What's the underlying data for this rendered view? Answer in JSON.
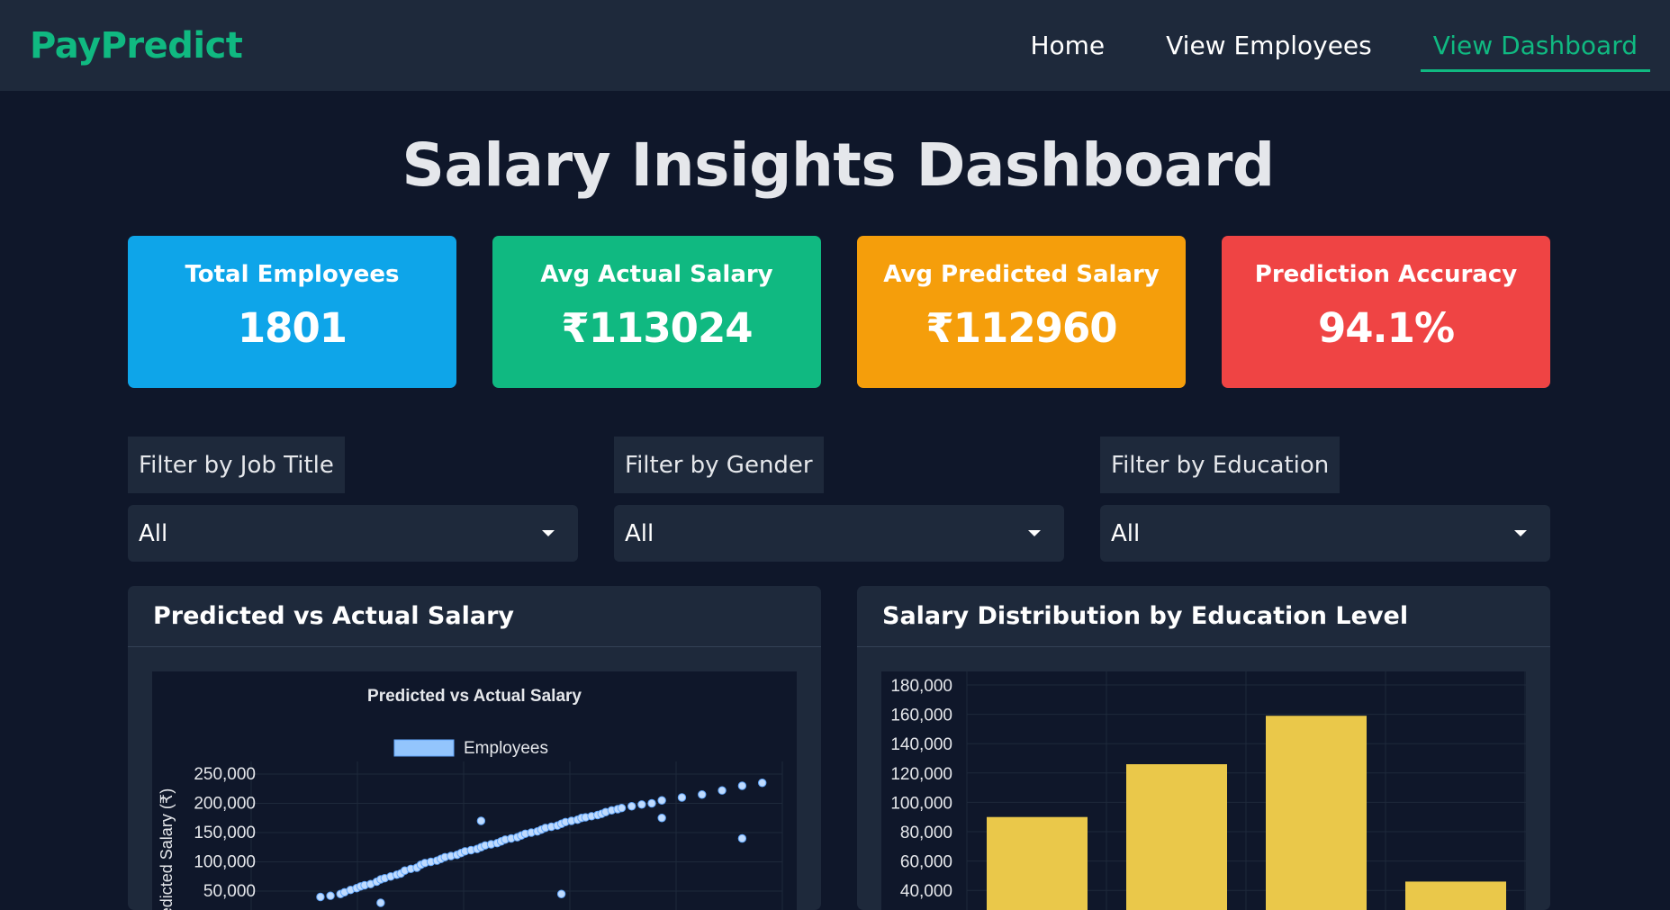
{
  "navbar": {
    "brand": "PayPredict",
    "links": [
      "Home",
      "View Employees",
      "View Dashboard"
    ],
    "active_link": "View Dashboard"
  },
  "page_title": "Salary Insights Dashboard",
  "stats": [
    {
      "label": "Total Employees",
      "value": "1801",
      "color": "#0ea5e9"
    },
    {
      "label": "Avg Actual Salary",
      "value": "₹113024",
      "color": "#10b981"
    },
    {
      "label": "Avg Predicted Salary",
      "value": "₹112960",
      "color": "#f59e0b"
    },
    {
      "label": "Prediction Accuracy",
      "value": "94.1%",
      "color": "#ef4444"
    }
  ],
  "filters": [
    {
      "label": "Filter by Job Title",
      "value": "All"
    },
    {
      "label": "Filter by Gender",
      "value": "All"
    },
    {
      "label": "Filter by Education",
      "value": "All"
    }
  ],
  "panels": {
    "scatter_title": "Predicted vs Actual Salary",
    "bar_title": "Salary Distribution by Education Level"
  },
  "chart_data": [
    {
      "type": "scatter",
      "title": "Predicted vs Actual Salary",
      "legend": [
        "Employees"
      ],
      "ylabel": "Predicted Salary (₹)",
      "yticks": [
        "250,000",
        "200,000",
        "150,000",
        "100,000",
        "50,000"
      ],
      "ylim": [
        0,
        250000
      ],
      "series_color": "#93c5fd",
      "points_x": [
        30000,
        35000,
        40000,
        42000,
        45000,
        48000,
        50000,
        52000,
        55000,
        58000,
        60000,
        62000,
        65000,
        68000,
        70000,
        72000,
        75000,
        78000,
        80000,
        82000,
        85000,
        88000,
        90000,
        92000,
        95000,
        98000,
        100000,
        102000,
        105000,
        108000,
        110000,
        112000,
        115000,
        118000,
        120000,
        122000,
        125000,
        128000,
        130000,
        132000,
        135000,
        138000,
        140000,
        142000,
        145000,
        148000,
        150000,
        152000,
        155000,
        158000,
        160000,
        162000,
        165000,
        168000,
        170000,
        172000,
        175000,
        178000,
        180000,
        185000,
        190000,
        195000,
        200000,
        210000,
        220000,
        230000,
        240000,
        250000,
        60000,
        110000,
        150000,
        200000,
        240000
      ],
      "points_y": [
        40000,
        42000,
        45000,
        48000,
        52000,
        55000,
        58000,
        60000,
        62000,
        66000,
        70000,
        72000,
        75000,
        78000,
        80000,
        85000,
        88000,
        90000,
        95000,
        98000,
        100000,
        102000,
        105000,
        108000,
        110000,
        112000,
        115000,
        118000,
        120000,
        122000,
        125000,
        128000,
        130000,
        132000,
        135000,
        138000,
        140000,
        142000,
        145000,
        148000,
        150000,
        152000,
        155000,
        158000,
        160000,
        162000,
        165000,
        168000,
        170000,
        172000,
        175000,
        176000,
        178000,
        180000,
        182000,
        185000,
        188000,
        190000,
        192000,
        195000,
        198000,
        200000,
        205000,
        210000,
        215000,
        222000,
        230000,
        235000,
        30000,
        170000,
        45000,
        175000,
        140000
      ]
    },
    {
      "type": "bar",
      "title": "Salary Distribution by Education Level",
      "yticks": [
        "180,000",
        "160,000",
        "140,000",
        "120,000",
        "100,000",
        "80,000",
        "60,000",
        "40,000"
      ],
      "ylim": [
        0,
        180000
      ],
      "values": [
        90000,
        126000,
        159000,
        46000
      ],
      "bar_color": "#eac84a"
    }
  ]
}
